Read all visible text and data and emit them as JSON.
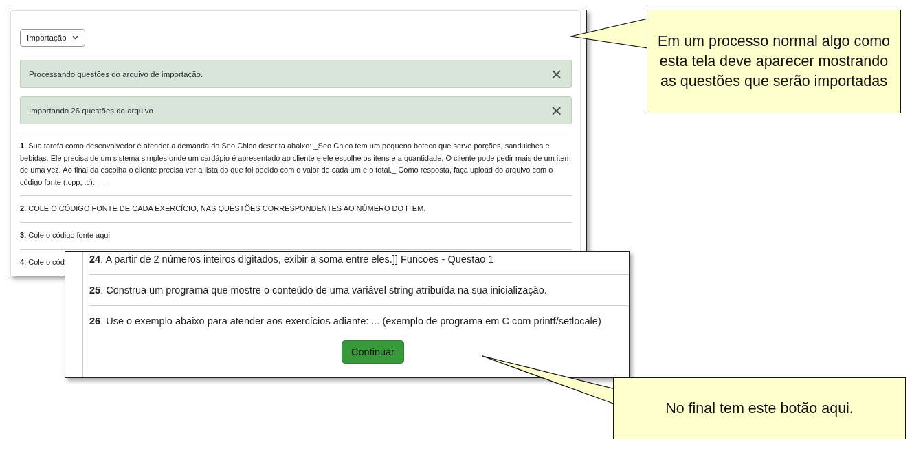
{
  "import_screen": {
    "dropdown": "Importação",
    "alerts": [
      {
        "text": "Processando questões do arquivo de importação.",
        "close": "×"
      },
      {
        "text": "Importando 26 questões do arquivo",
        "close": "×"
      }
    ],
    "questions": [
      {
        "text": "**1**. Sua tarefa como desenvolvedor é atender a demanda do Seo Chico descrita abaixo: _Seo Chico tem um pequeno boteco que serve porções, sanduiches e bebidas. Ele precisa de um sistema simples onde um cardápio é apresentado ao cliente e ele escolhe os itens e a quantidade. O cliente pode pedir mais de um item de uma vez. Ao final da escolha o cliente precisa ver a lista do que foi pedido com o valor de cada um e o total._ Como resposta, faça upload do arquivo com o código fonte (.cpp, .c)._ _"
      },
      {
        "text": "**2**. COLE O CÓDIGO FONTE DE CADA EXERCÍCIO, NAS QUESTÕES CORRESPONDENTES AO NÚMERO DO ITEM."
      },
      {
        "text": "**3**. Cole o código fonte aqui"
      },
      {
        "text": "**4**. Cole o cód"
      }
    ]
  },
  "final_screen": {
    "questions": [
      {
        "text": "**24**. A partir de 2 números inteiros digitados, exibir a soma entre eles.]] Funcoes - Questao 1"
      },
      {
        "text": "**25**. Construa um programa que mostre o conteúdo de uma variável string atribuída na sua inicialização."
      },
      {
        "text": "**26**. Use o exemplo abaixo para atender aos exercícios adiante: ... (exemplo de programa em C com printf/setlocale)"
      }
    ],
    "button": "Continuar"
  },
  "callouts": [
    {
      "text": "Em um processo normal algo como esta tela deve aparecer mostrando as questões que serão importadas"
    },
    {
      "text": "No final tem este botão aqui."
    }
  ]
}
